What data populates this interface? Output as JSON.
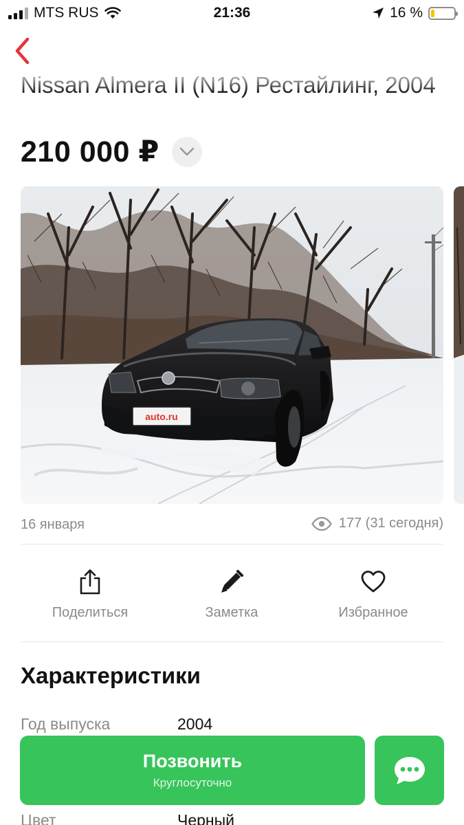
{
  "status_bar": {
    "carrier": "MTS RUS",
    "time": "21:36",
    "battery": "16 %",
    "battery_level": 0.16
  },
  "listing": {
    "title": "Nissan Almera II (N16) Рестайлинг, 2004",
    "price": "210 000 ₽",
    "plate_text": "auto.ru",
    "date": "16 января",
    "views": "177 (31 сегодня)"
  },
  "actions": [
    {
      "label": "Поделиться",
      "icon": "share-icon"
    },
    {
      "label": "Заметка",
      "icon": "pencil-icon"
    },
    {
      "label": "Избранное",
      "icon": "heart-icon"
    }
  ],
  "characteristics": {
    "title": "Характеристики",
    "rows": [
      {
        "label": "Год выпуска",
        "value": "2004"
      },
      {
        "label": "Цвет",
        "value": "Черный"
      }
    ]
  },
  "bottom_bar": {
    "call_label": "Позвонить",
    "call_sub": "Круглосуточно",
    "chat_icon": "chat-bubble-icon"
  },
  "colors": {
    "accent_green": "#37c45a",
    "back_arrow": "#e8323c",
    "battery": "#f2c500"
  }
}
